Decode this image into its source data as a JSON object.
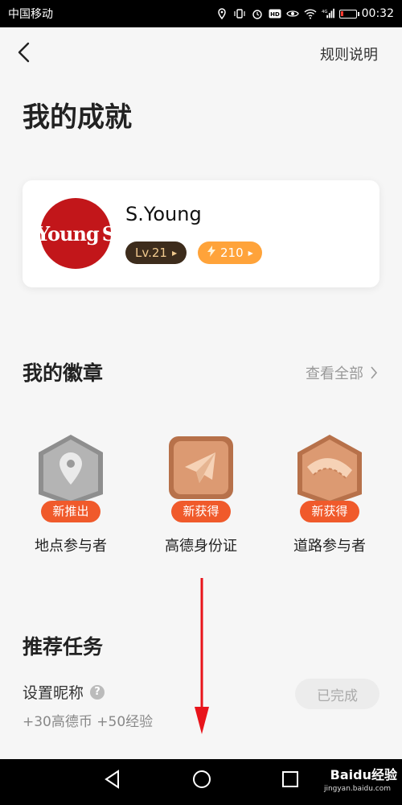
{
  "status_bar": {
    "carrier": "中国移动",
    "time": "00:32",
    "battery_level": 0.15,
    "network": "4G"
  },
  "header": {
    "rules_label": "规则说明"
  },
  "page_title": "我的成就",
  "profile": {
    "avatar_text_main": "Young",
    "avatar_text_end": "S",
    "name": "S.Young",
    "level": "Lv.21",
    "points": "210"
  },
  "badges": {
    "title": "我的徽章",
    "view_all": "查看全部",
    "items": [
      {
        "label": "地点参与者",
        "tag": "新推出",
        "style": "silver"
      },
      {
        "label": "高德身份证",
        "tag": "新获得",
        "style": "bronze"
      },
      {
        "label": "道路参与者",
        "tag": "新获得",
        "style": "bronze"
      }
    ]
  },
  "tasks": {
    "title": "推荐任务",
    "items": [
      {
        "name": "设置昵称",
        "reward": "+30高德币 +50经验",
        "status": "已完成"
      }
    ]
  },
  "watermark": {
    "brand": "Baidu经验",
    "url": "jingyan.baidu.com"
  },
  "colors": {
    "accent_orange": "#ffa33a",
    "tag_red": "#f05a2b",
    "level_dark": "#3d2c1c",
    "annotation_red": "#e8141b"
  }
}
